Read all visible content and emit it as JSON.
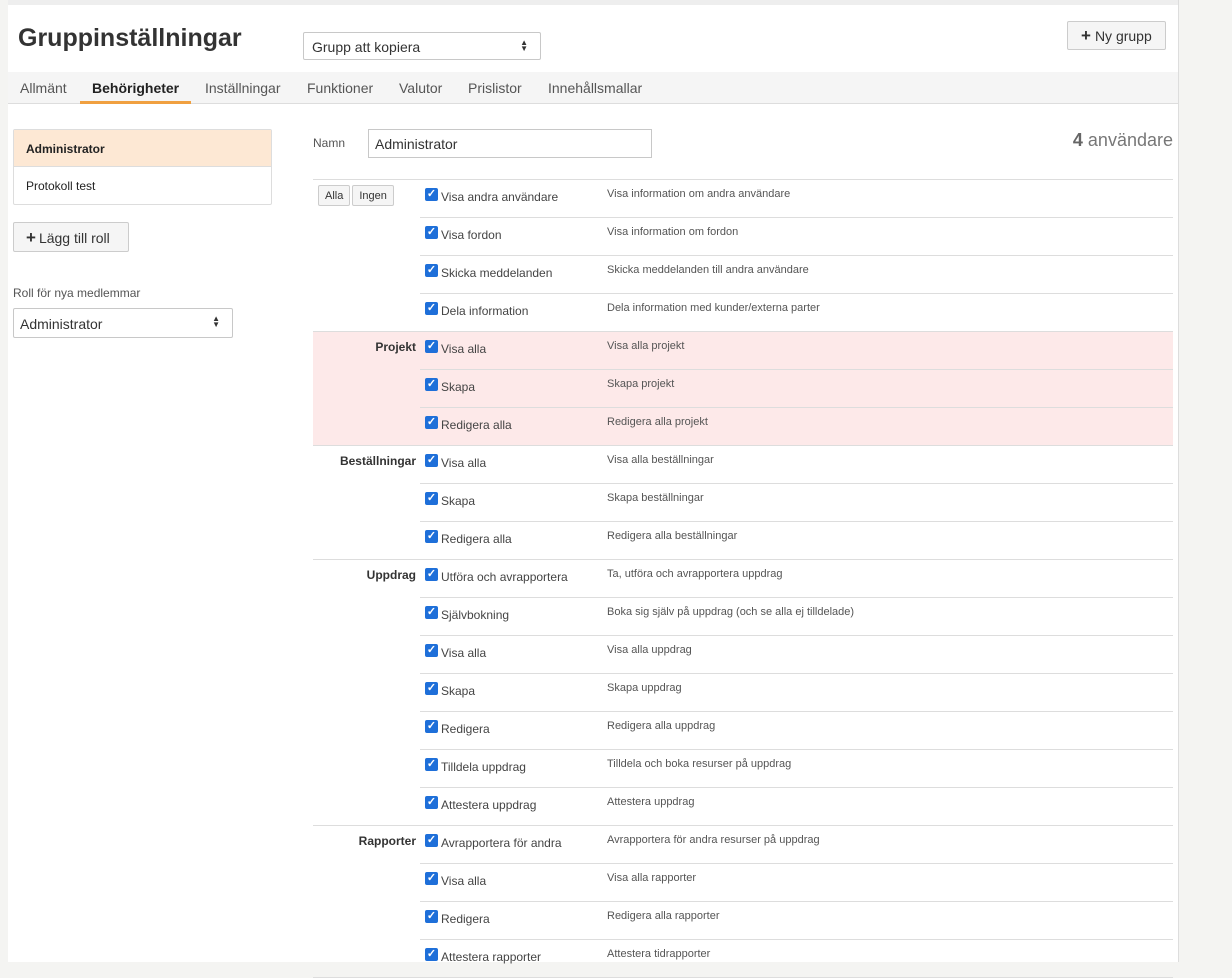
{
  "header": {
    "title": "Gruppinställningar",
    "copy_select": "Grupp att kopiera",
    "new_group": "Ny grupp"
  },
  "tabs": [
    "Allmänt",
    "Behörigheter",
    "Inställningar",
    "Funktioner",
    "Valutor",
    "Prislistor",
    "Innehållsmallar"
  ],
  "active_tab": "Behörigheter",
  "roles": [
    "Administrator",
    "Protokoll test"
  ],
  "add_role": "Lägg till roll",
  "default_role": {
    "label": "Roll för nya medlemmar",
    "value": "Administrator"
  },
  "name_field": {
    "label": "Namn",
    "value": "Administrator"
  },
  "users": {
    "count": "4",
    "label": "användare"
  },
  "buttons": {
    "all": "Alla",
    "none": "Ingen"
  },
  "groups": [
    {
      "name": "",
      "pink": false,
      "rows": [
        {
          "label": "Visa andra användare",
          "desc": "Visa information om andra användare",
          "checked": true
        },
        {
          "label": "Visa fordon",
          "desc": "Visa information om fordon",
          "checked": true
        },
        {
          "label": "Skicka meddelanden",
          "desc": "Skicka meddelanden till andra användare",
          "checked": true
        },
        {
          "label": "Dela information",
          "desc": "Dela information med kunder/externa parter",
          "checked": true
        }
      ]
    },
    {
      "name": "Projekt",
      "pink": true,
      "rows": [
        {
          "label": "Visa alla",
          "desc": "Visa alla projekt",
          "checked": true
        },
        {
          "label": "Skapa",
          "desc": "Skapa projekt",
          "checked": true
        },
        {
          "label": "Redigera alla",
          "desc": "Redigera alla projekt",
          "checked": true
        }
      ]
    },
    {
      "name": "Beställningar",
      "pink": false,
      "rows": [
        {
          "label": "Visa alla",
          "desc": "Visa alla beställningar",
          "checked": true
        },
        {
          "label": "Skapa",
          "desc": "Skapa beställningar",
          "checked": true
        },
        {
          "label": "Redigera alla",
          "desc": "Redigera alla beställningar",
          "checked": true
        }
      ]
    },
    {
      "name": "Uppdrag",
      "pink": false,
      "rows": [
        {
          "label": "Utföra och avrapportera",
          "desc": "Ta, utföra och avrapportera uppdrag",
          "checked": true
        },
        {
          "label": "Självbokning",
          "desc": "Boka sig själv på uppdrag (och se alla ej tilldelade)",
          "checked": true
        },
        {
          "label": "Visa alla",
          "desc": "Visa alla uppdrag",
          "checked": true
        },
        {
          "label": "Skapa",
          "desc": "Skapa uppdrag",
          "checked": true
        },
        {
          "label": "Redigera",
          "desc": "Redigera alla uppdrag",
          "checked": true
        },
        {
          "label": "Tilldela uppdrag",
          "desc": "Tilldela och boka resurser på uppdrag",
          "checked": true
        },
        {
          "label": "Attestera uppdrag",
          "desc": "Attestera uppdrag",
          "checked": true
        }
      ]
    },
    {
      "name": "Rapporter",
      "pink": false,
      "rows": [
        {
          "label": "Avrapportera för andra",
          "desc": "Avrapportera för andra resurser på uppdrag",
          "checked": true
        },
        {
          "label": "Visa alla",
          "desc": "Visa alla rapporter",
          "checked": true
        },
        {
          "label": "Redigera",
          "desc": "Redigera alla rapporter",
          "checked": true
        },
        {
          "label": "Attestera rapporter",
          "desc": "Attestera tidrapporter",
          "checked": true
        }
      ]
    }
  ]
}
